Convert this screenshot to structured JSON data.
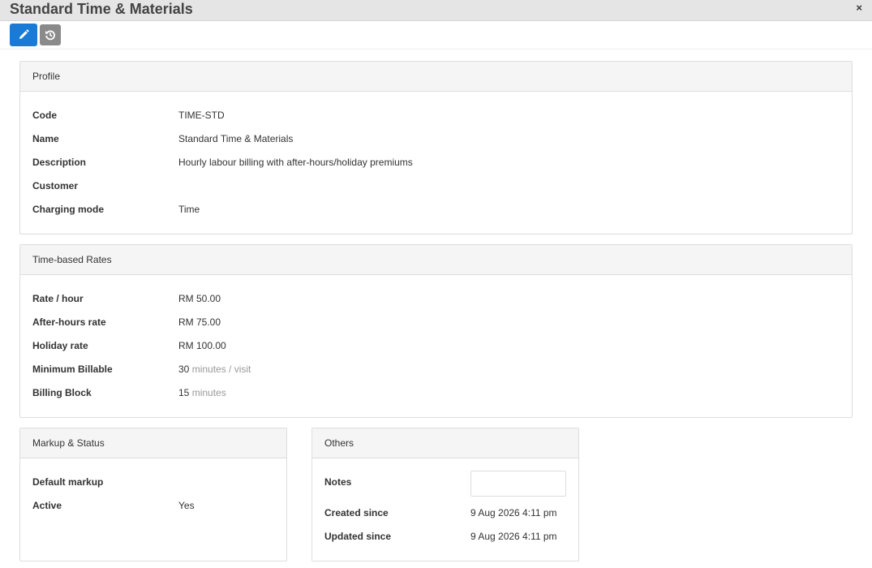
{
  "window": {
    "title": "Standard Time & Materials",
    "close_glyph": "×"
  },
  "toolbar": {
    "edit_icon": "pencil-icon",
    "revert_icon": "history-icon"
  },
  "profile": {
    "heading": "Profile",
    "rows": [
      {
        "label": "Code",
        "value": "TIME-STD"
      },
      {
        "label": "Name",
        "value": "Standard Time & Materials"
      },
      {
        "label": "Description",
        "value": "Hourly labour billing with after-hours/holiday premiums"
      },
      {
        "label": "Customer",
        "value": ""
      },
      {
        "label": "Charging mode",
        "value": "Time"
      }
    ]
  },
  "rates": {
    "heading": "Time-based Rates",
    "rows": [
      {
        "label": "Rate / hour",
        "value": "RM 50.00",
        "unit": ""
      },
      {
        "label": "After-hours rate",
        "value": "RM 75.00",
        "unit": ""
      },
      {
        "label": "Holiday rate",
        "value": "RM 100.00",
        "unit": ""
      },
      {
        "label": "Minimum Billable",
        "value": "30",
        "unit": "minutes / visit"
      },
      {
        "label": "Billing Block",
        "value": "15",
        "unit": "minutes"
      }
    ]
  },
  "markup": {
    "heading": "Markup & Status",
    "rows": [
      {
        "label": "Default markup",
        "value": ""
      },
      {
        "label": "Active",
        "value": "Yes"
      }
    ]
  },
  "others": {
    "heading": "Others",
    "notes_label": "Notes",
    "notes_value": "",
    "rows": [
      {
        "label": "Created since",
        "value": "9 Aug 2026 4:11 pm"
      },
      {
        "label": "Updated since",
        "value": "9 Aug 2026 4:11 pm"
      }
    ]
  }
}
